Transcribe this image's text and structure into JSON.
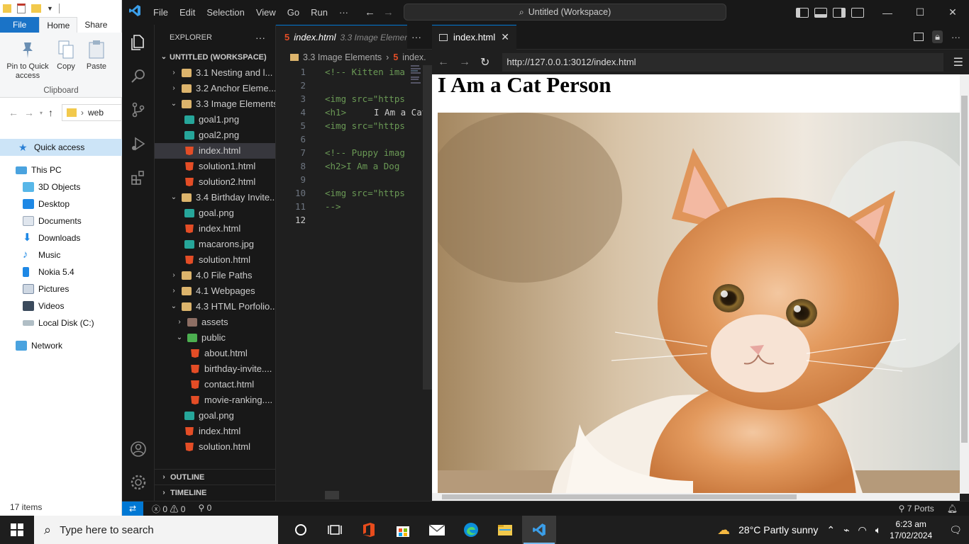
{
  "explorer": {
    "tabs": {
      "file": "File",
      "home": "Home",
      "share": "Share"
    },
    "ribbon": {
      "pin": "Pin to Quick access",
      "copy": "Copy",
      "paste": "Paste",
      "group": "Clipboard"
    },
    "address": "web",
    "quick_access": "Quick access",
    "nav": [
      {
        "label": "This PC",
        "icon": "pc-icon"
      },
      {
        "label": "3D Objects",
        "icon": "cube-icon"
      },
      {
        "label": "Desktop",
        "icon": "desktop-icon"
      },
      {
        "label": "Documents",
        "icon": "documents-icon"
      },
      {
        "label": "Downloads",
        "icon": "downloads-icon"
      },
      {
        "label": "Music",
        "icon": "music-icon"
      },
      {
        "label": "Nokia 5.4",
        "icon": "phone-icon"
      },
      {
        "label": "Pictures",
        "icon": "pictures-icon"
      },
      {
        "label": "Videos",
        "icon": "videos-icon"
      },
      {
        "label": "Local Disk (C:)",
        "icon": "disk-icon"
      },
      {
        "label": "Network",
        "icon": "network-icon"
      }
    ],
    "status": "17 items"
  },
  "vscode": {
    "menu": [
      "File",
      "Edit",
      "Selection",
      "View",
      "Go",
      "Run",
      "···"
    ],
    "command_center": "Untitled (Workspace)",
    "sidebar": {
      "title": "EXPLORER",
      "workspace": "UNTITLED (WORKSPACE)",
      "tree": [
        {
          "label": "3.1 Nesting and l...",
          "depth": 1,
          "type": "folder",
          "open": false
        },
        {
          "label": "3.2 Anchor Eleme...",
          "depth": 1,
          "type": "folder",
          "open": false
        },
        {
          "label": "3.3 Image Elements",
          "depth": 1,
          "type": "folder",
          "open": true
        },
        {
          "label": "goal1.png",
          "depth": 2,
          "type": "image"
        },
        {
          "label": "goal2.png",
          "depth": 2,
          "type": "image"
        },
        {
          "label": "index.html",
          "depth": 2,
          "type": "html",
          "selected": true
        },
        {
          "label": "solution1.html",
          "depth": 2,
          "type": "html"
        },
        {
          "label": "solution2.html",
          "depth": 2,
          "type": "html"
        },
        {
          "label": "3.4 Birthday Invite...",
          "depth": 1,
          "type": "folder",
          "open": true
        },
        {
          "label": "goal.png",
          "depth": 2,
          "type": "image"
        },
        {
          "label": "index.html",
          "depth": 2,
          "type": "html"
        },
        {
          "label": "macarons.jpg",
          "depth": 2,
          "type": "image"
        },
        {
          "label": "solution.html",
          "depth": 2,
          "type": "html"
        },
        {
          "label": "4.0 File Paths",
          "depth": 1,
          "type": "folder",
          "open": false
        },
        {
          "label": "4.1 Webpages",
          "depth": 1,
          "type": "folder",
          "open": false
        },
        {
          "label": "4.3 HTML Porfolio...",
          "depth": 1,
          "type": "folder",
          "open": true
        },
        {
          "label": "assets",
          "depth": 2,
          "type": "assets",
          "open": false
        },
        {
          "label": "public",
          "depth": 2,
          "type": "public",
          "open": true
        },
        {
          "label": "about.html",
          "depth": 3,
          "type": "html"
        },
        {
          "label": "birthday-invite....",
          "depth": 3,
          "type": "html"
        },
        {
          "label": "contact.html",
          "depth": 3,
          "type": "html"
        },
        {
          "label": "movie-ranking....",
          "depth": 3,
          "type": "html"
        },
        {
          "label": "goal.png",
          "depth": 2,
          "type": "image"
        },
        {
          "label": "index.html",
          "depth": 2,
          "type": "html"
        },
        {
          "label": "solution.html",
          "depth": 2,
          "type": "html"
        }
      ],
      "outline": "OUTLINE",
      "timeline": "TIMELINE"
    },
    "editor": {
      "tab_name": "index.html",
      "tab_desc": "3.3 Image Elemen",
      "breadcrumb": [
        "3.3 Image Elements",
        "index."
      ],
      "lines": [
        {
          "n": "1",
          "parts": [
            [
              "cm",
              "<!-- Kitten ima"
            ]
          ]
        },
        {
          "n": "2",
          "parts": []
        },
        {
          "n": "3",
          "parts": [
            [
              "cm",
              "<img src=\"https"
            ]
          ]
        },
        {
          "n": "4",
          "parts": [
            [
              "cm",
              "<h1>"
            ],
            [
              "tx",
              "I Am a Cat"
            ]
          ]
        },
        {
          "n": "5",
          "parts": [
            [
              "cm",
              "<img "
            ],
            [
              "cm",
              "src="
            ],
            [
              "cm",
              "\"https"
            ]
          ]
        },
        {
          "n": "6",
          "parts": []
        },
        {
          "n": "7",
          "parts": [
            [
              "cm",
              "<!-- Puppy imag"
            ]
          ]
        },
        {
          "n": "8",
          "parts": [
            [
              "cm",
              "<h2>I Am a Dog"
            ]
          ]
        },
        {
          "n": "9",
          "parts": []
        },
        {
          "n": "10",
          "parts": [
            [
              "cm",
              "<img src=\"https"
            ]
          ]
        },
        {
          "n": "11",
          "parts": [
            [
              "cm",
              "-->"
            ]
          ]
        },
        {
          "n": "12",
          "parts": []
        }
      ]
    },
    "preview": {
      "tab_name": "index.html",
      "url": "http://127.0.0.1:3012/index.html",
      "heading": "I Am a Cat Person"
    },
    "status": {
      "errors": "0",
      "warnings": "0",
      "ports_info": "0",
      "ports": "7 Ports"
    }
  },
  "taskbar": {
    "search_placeholder": "Type here to search",
    "weather": "28°C  Partly sunny",
    "time": "6:23 am",
    "date": "17/02/2024"
  }
}
